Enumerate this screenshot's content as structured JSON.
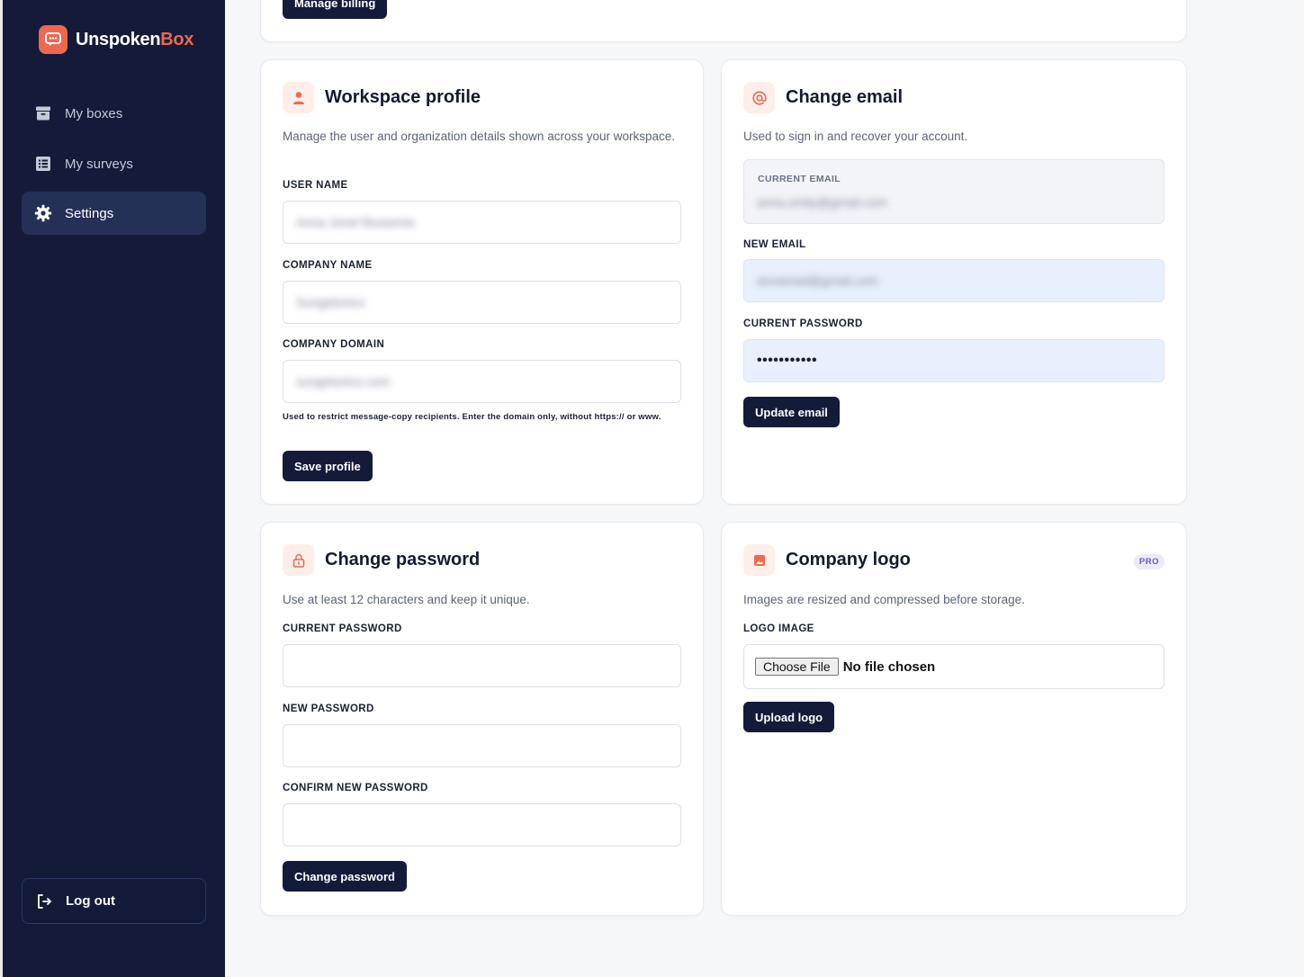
{
  "brand": {
    "name_main": "Unspoken",
    "name_accent": "Box",
    "accent_color": "#f0674f",
    "icon": "chat-bubble-icon"
  },
  "sidebar": {
    "items": [
      {
        "label": "My boxes",
        "icon": "archive-box-icon",
        "active": false
      },
      {
        "label": "My surveys",
        "icon": "list-icon",
        "active": false
      },
      {
        "label": "Settings",
        "icon": "gear-icon",
        "active": true
      }
    ],
    "logout_label": "Log out"
  },
  "billing": {
    "button_label": "Manage billing"
  },
  "workspace": {
    "title": "Workspace profile",
    "description": "Manage the user and organization details shown across your workspace.",
    "user_name_label": "USER NAME",
    "user_name_value": "Anna Jonel Bussenia",
    "company_name_label": "COMPANY NAME",
    "company_name_value": "Sungelonics",
    "company_domain_label": "COMPANY DOMAIN",
    "company_domain_value": "sungelonics.com",
    "domain_hint": "Used to restrict message-copy recipients. Enter the domain only, without https:// or www.",
    "save_label": "Save profile"
  },
  "email": {
    "title": "Change email",
    "description": "Used to sign in and recover your account.",
    "current_email_label": "CURRENT EMAIL",
    "current_email_value": "anna.smily@gmail.com",
    "new_email_label": "NEW EMAIL",
    "new_email_value": "annamail@gmail.com",
    "current_password_label": "CURRENT PASSWORD",
    "current_password_value": "•••••••••••",
    "update_label": "Update email"
  },
  "password": {
    "title": "Change password",
    "description": "Use at least 12 characters and keep it unique.",
    "current_label": "CURRENT PASSWORD",
    "new_label": "NEW PASSWORD",
    "confirm_label": "CONFIRM NEW PASSWORD",
    "button_label": "Change password"
  },
  "logo": {
    "title": "Company logo",
    "badge": "PRO",
    "description": "Images are resized and compressed before storage.",
    "field_label": "LOGO IMAGE",
    "choose_label": "Choose File",
    "no_file_label": "No file chosen",
    "upload_label": "Upload logo"
  }
}
